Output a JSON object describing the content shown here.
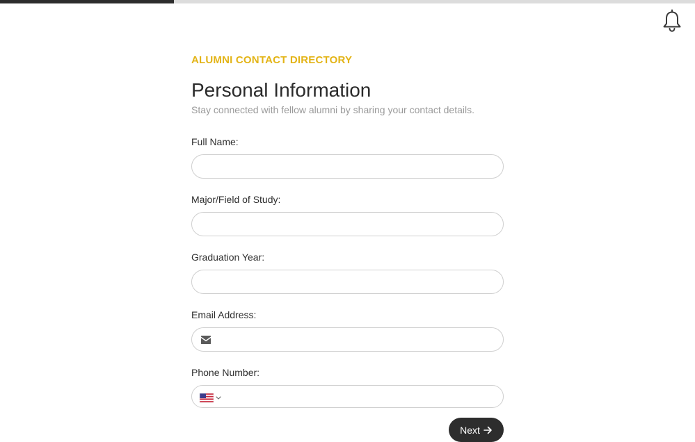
{
  "progress": {
    "fraction": 0.25
  },
  "header": {
    "eyebrow": "ALUMNI CONTACT DIRECTORY",
    "title": "Personal Information",
    "subtitle": "Stay connected with fellow alumni by sharing your contact details."
  },
  "form": {
    "full_name": {
      "label": "Full Name:",
      "value": "",
      "placeholder": ""
    },
    "major": {
      "label": "Major/Field of Study:",
      "value": "",
      "placeholder": ""
    },
    "graduation_year": {
      "label": "Graduation Year:",
      "value": "",
      "placeholder": ""
    },
    "email": {
      "label": "Email Address:",
      "value": "",
      "placeholder": "",
      "icon": "envelope-icon"
    },
    "phone": {
      "label": "Phone Number:",
      "value": "",
      "placeholder": "",
      "country_icon": "us-flag-icon"
    },
    "next_label": "Next",
    "next_icon": "arrow-right-icon"
  },
  "icons": {
    "notifications": "bell-icon"
  },
  "colors": {
    "accent": "#e3b417",
    "button_bg": "#2d2d2d",
    "progress_fill": "#2d2d2d",
    "progress_track": "#dcdcdc",
    "subtitle": "#9a9a9a"
  }
}
